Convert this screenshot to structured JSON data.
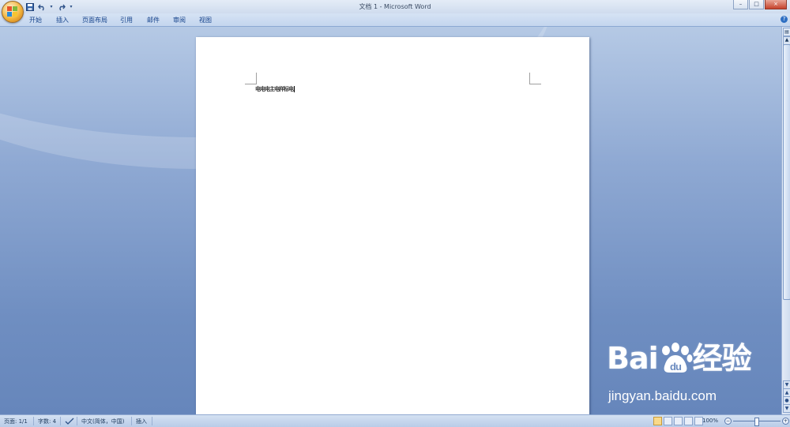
{
  "window": {
    "title": "文档 1 - Microsoft Word",
    "controls": {
      "minimize": "–",
      "maximize": "□",
      "close": "×"
    }
  },
  "quick_access": {
    "save_icon": "floppy-disk-icon",
    "undo_icon": "undo-icon",
    "redo_icon": "redo-icon",
    "customize_icon": "dropdown-arrow-icon"
  },
  "ribbon": {
    "tabs": [
      "开始",
      "插入",
      "页面布局",
      "引用",
      "邮件",
      "审阅",
      "视图"
    ],
    "help": "?"
  },
  "document": {
    "text": "电电电主电样标电"
  },
  "scrollbar": {
    "ruler_icon": "▤",
    "up": "▲",
    "prev": "▲",
    "browse": "●",
    "next": "▼",
    "down": "▼"
  },
  "status": {
    "page": "页面: 1/1",
    "words": "字数: 4",
    "language": "中文(简体，中国)",
    "mode": "插入",
    "zoom": "100%",
    "zoom_minus": "−",
    "zoom_plus": "+"
  },
  "watermark": {
    "brand": "Bai",
    "brand_cn": "经验",
    "url": "jingyan.baidu.com"
  },
  "colors": {
    "accent": "#15428b",
    "workspace": "#8fa9d3",
    "office_orange": "#f2b53d"
  }
}
